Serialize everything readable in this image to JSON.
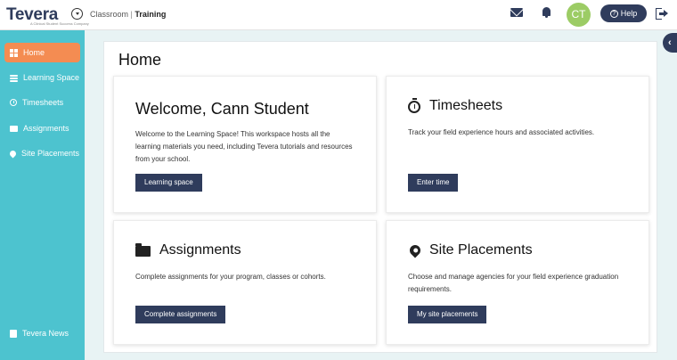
{
  "header": {
    "logo": "Tevera",
    "logo_sub": "A Clinical Student Success Company",
    "breadcrumb": {
      "root": "Classroom",
      "separator": "|",
      "current": "Training"
    },
    "avatar_initials": "CT",
    "help_label": "Help",
    "icons": [
      "chevron-down-icon",
      "mail-icon",
      "bell-icon",
      "help-icon",
      "logout-icon"
    ]
  },
  "sidebar": {
    "items": [
      {
        "label": "Home",
        "icon": "grid-icon",
        "active": true
      },
      {
        "label": "Learning Space",
        "icon": "layers-icon",
        "active": false
      },
      {
        "label": "Timesheets",
        "icon": "stopwatch-icon",
        "active": false
      },
      {
        "label": "Assignments",
        "icon": "folder-icon",
        "active": false
      },
      {
        "label": "Site Placements",
        "icon": "map-pin-icon",
        "active": false
      }
    ],
    "footer_item": {
      "label": "Tevera News",
      "icon": "news-icon"
    }
  },
  "main": {
    "title": "Home",
    "cards": [
      {
        "title": "Welcome, Cann Student",
        "text": "Welcome to the Learning Space! This workspace hosts all the learning materials you need, including Tevera tutorials and resources from your school.",
        "button": "Learning space"
      },
      {
        "title": "Timesheets",
        "icon": "stopwatch-icon",
        "text": "Track your field experience hours and associated activities.",
        "button": "Enter time"
      },
      {
        "title": "Assignments",
        "icon": "folder-icon",
        "text": "Complete assignments for your program, classes or cohorts.",
        "button": "Complete assignments"
      },
      {
        "title": "Site Placements",
        "icon": "map-pin-icon",
        "text": "Choose and manage agencies for your field experience graduation requirements.",
        "button": "My site placements"
      }
    ]
  },
  "colors": {
    "accent_navy": "#2f3c5c",
    "sidebar_teal": "#4dc3cf",
    "active_orange": "#f48c52",
    "avatar_green": "#9ccc65"
  }
}
